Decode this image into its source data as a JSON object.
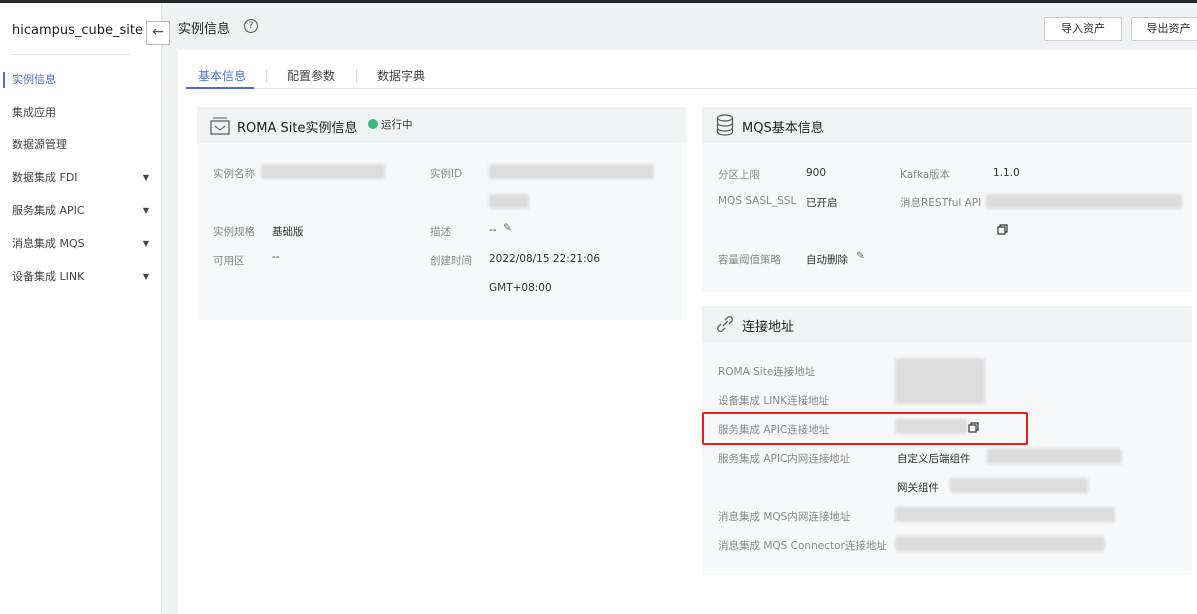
{
  "sidebar": {
    "site_name": "hicampus_cube_site",
    "items": [
      {
        "label": "实例信息",
        "active": true
      },
      {
        "label": "集成应用"
      },
      {
        "label": "数据源管理"
      },
      {
        "label": "数据集成 FDI",
        "expandable": true
      },
      {
        "label": "服务集成 APIC",
        "expandable": true
      },
      {
        "label": "消息集成 MQS",
        "expandable": true
      },
      {
        "label": "设备集成 LINK",
        "expandable": true
      }
    ]
  },
  "header": {
    "title": "实例信息",
    "help": "?",
    "back": "←",
    "import_label": "导入资产",
    "export_label": "导出资产"
  },
  "tabs": [
    {
      "label": "基本信息",
      "active": true
    },
    {
      "label": "配置参数"
    },
    {
      "label": "数据字典"
    }
  ],
  "roma": {
    "title": "ROMA Site实例信息",
    "status": "运行中",
    "status_color": "#3cb978",
    "name_label": "实例名称",
    "id_label": "实例ID",
    "spec_label": "实例规格",
    "spec_value": "基础版",
    "desc_label": "描述",
    "desc_value": "--",
    "az_label": "可用区",
    "az_value": "--",
    "created_label": "创建时间",
    "created_value": "2022/08/15 22:21:06",
    "timezone": "GMT+08:00"
  },
  "mqs": {
    "title": "MQS基本信息",
    "partition_label": "分区上限",
    "partition_value": "900",
    "kafka_label": "Kafka版本",
    "kafka_value": "1.1.0",
    "sasl_label": "MQS SASL_SSL",
    "sasl_value": "已开启",
    "restful_label": "消息RESTful API",
    "policy_label": "容量阈值策略",
    "policy_value": "自动删除"
  },
  "conn": {
    "title": "连接地址",
    "rows": [
      "ROMA Site连接地址",
      "设备集成 LINK连接地址",
      "服务集成 APIC连接地址",
      "服务集成 APIC内网连接地址",
      "消息集成 MQS内网连接地址",
      "消息集成 MQS Connector连接地址"
    ],
    "custom_backend": "自定义后端组件",
    "gateway": "网关组件",
    "highlight_color": "#f01c1c"
  }
}
